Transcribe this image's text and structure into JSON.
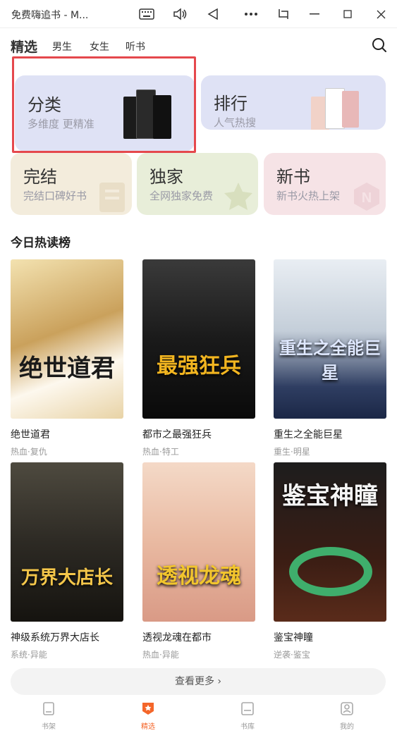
{
  "window": {
    "title": "免费嗨追书 - M..."
  },
  "topnav": {
    "tabs": [
      "精选",
      "男生",
      "女生",
      "听书"
    ]
  },
  "categories": {
    "fenlei": {
      "title": "分类",
      "sub": "多维度 更精准"
    },
    "paihang": {
      "title": "排行",
      "sub": "人气热搜"
    },
    "wanjie": {
      "title": "完结",
      "sub": "完结口碑好书"
    },
    "dujia": {
      "title": "独家",
      "sub": "全网独家免费"
    },
    "xinshu": {
      "title": "新书",
      "sub": "新书火热上架"
    }
  },
  "section": {
    "title": "今日热读榜"
  },
  "books": [
    {
      "name": "绝世道君",
      "tags": "热血·复仇",
      "cover_text": "绝世道君"
    },
    {
      "name": "都市之最强狂兵",
      "tags": "热血·特工",
      "cover_text": "最强狂兵"
    },
    {
      "name": "重生之全能巨星",
      "tags": "重生·明星",
      "cover_text": "重生之全能巨星"
    },
    {
      "name": "神级系统万界大店长",
      "tags": "系统·异能",
      "cover_text": "万界大店长"
    },
    {
      "name": "透视龙魂在都市",
      "tags": "热血·异能",
      "cover_text": "透视龙魂"
    },
    {
      "name": "鉴宝神瞳",
      "tags": "逆袭·鉴宝",
      "cover_text": "鉴宝神瞳"
    }
  ],
  "more_button": "查看更多",
  "bottom_nav": [
    {
      "label": "书架",
      "icon": "bookshelf-icon"
    },
    {
      "label": "精选",
      "icon": "featured-icon"
    },
    {
      "label": "书库",
      "icon": "library-icon"
    },
    {
      "label": "我的",
      "icon": "profile-icon"
    }
  ],
  "colors": {
    "accent": "#f4662a",
    "highlight": "#e5484d"
  }
}
